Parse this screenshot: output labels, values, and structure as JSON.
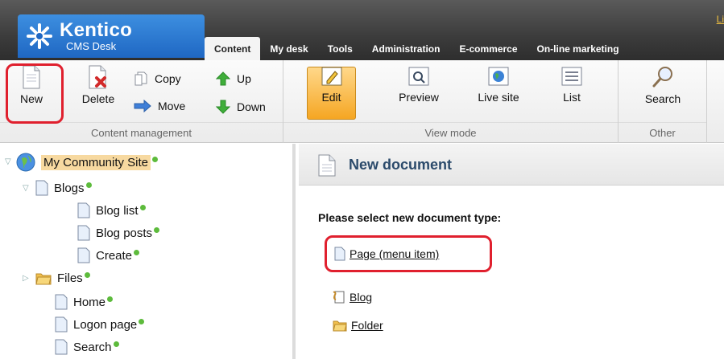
{
  "header": {
    "brand": "Kentico",
    "subtitle": "CMS Desk",
    "lang_link": "Li",
    "tabs": [
      "Content",
      "My desk",
      "Tools",
      "Administration",
      "E-commerce",
      "On-line marketing"
    ],
    "active_tab": "Content"
  },
  "ribbon": {
    "content_management": {
      "label": "Content management",
      "new": "New",
      "delete": "Delete",
      "copy": "Copy",
      "move": "Move",
      "up": "Up",
      "down": "Down"
    },
    "view_mode": {
      "label": "View mode",
      "edit": "Edit",
      "preview": "Preview",
      "live_site": "Live site",
      "list": "List"
    },
    "other": {
      "label": "Other",
      "search": "Search"
    }
  },
  "tree": {
    "root": "My Community Site",
    "blogs": "Blogs",
    "blog_list": "Blog list",
    "blog_posts": "Blog posts",
    "create": "Create",
    "files": "Files",
    "home": "Home",
    "logon_page": "Logon page",
    "search": "Search",
    "status_color": "#5dbb3c"
  },
  "pane": {
    "title": "New document",
    "prompt": "Please select new document type:",
    "types": [
      "Page (menu item)",
      "Blog",
      "Folder"
    ]
  },
  "colors": {
    "highlight": "#e0202e",
    "brand_blue": "#1f67c3",
    "active_button": "#f5a623"
  }
}
